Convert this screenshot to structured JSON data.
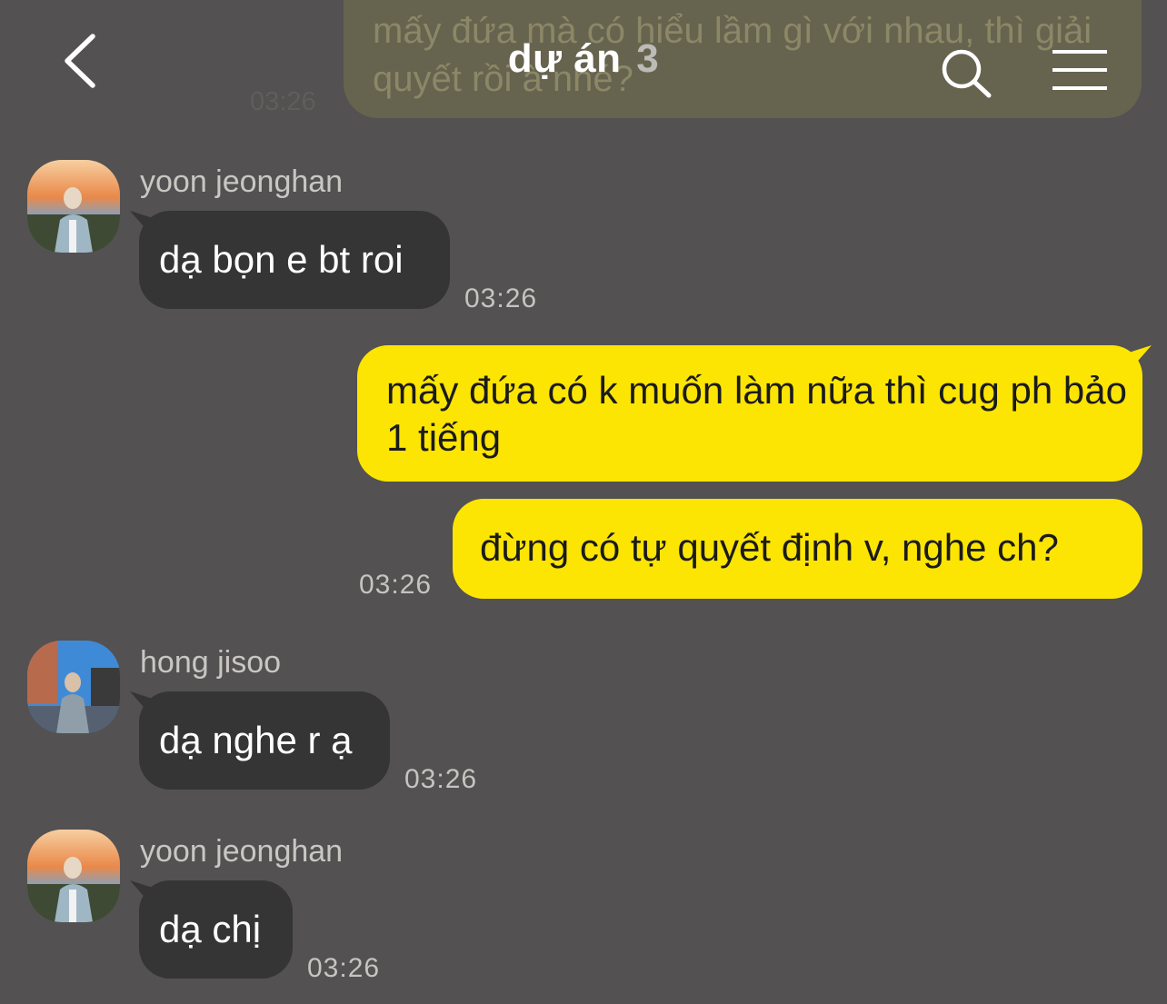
{
  "header": {
    "title": "dự án",
    "member_count": "3",
    "back_icon": "chevron-left-icon",
    "search_icon": "search-icon",
    "menu_icon": "hamburger-menu-icon"
  },
  "previous_message": {
    "text": "mấy đứa mà có hiểu lầm gì với nhau, thì giải quyết rồi à nhé?",
    "time": "03:26"
  },
  "messages": [
    {
      "sender": "yoon jeonghan",
      "text": "dạ bọn e bt roi",
      "time": "03:26"
    },
    {
      "text": "mấy đứa có k muốn làm nữa thì cug ph bảo 1 tiếng"
    },
    {
      "text": "đừng có tự quyết định v, nghe ch?",
      "time": "03:26"
    },
    {
      "sender": "hong jisoo",
      "text": "dạ nghe r ạ",
      "time": "03:26"
    },
    {
      "sender": "yoon jeonghan",
      "text": "dạ chị",
      "time": "03:26"
    }
  ],
  "colors": {
    "background": "#535151",
    "incoming_bubble": "#363535",
    "outgoing_bubble": "#fde503"
  }
}
